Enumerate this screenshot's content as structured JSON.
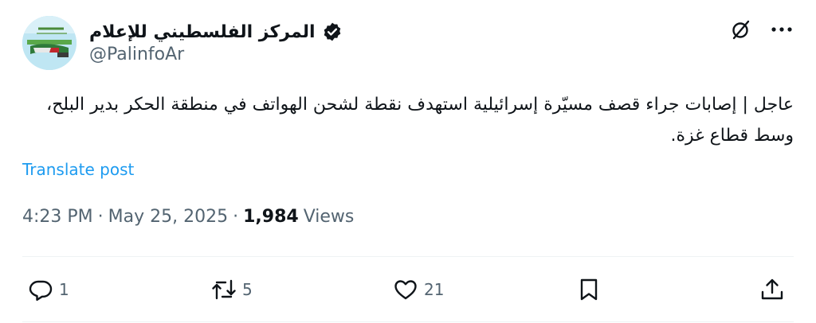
{
  "account": {
    "display_name": "المركز الفلسطيني للإعلام",
    "handle": "@PalinfoAr",
    "verified": true,
    "avatar_icon": "palinfo-logo"
  },
  "tweet": {
    "text": "عاجل | إصابات جراء قصف مسيّرة إسرائيلية استهدف نقطة لشحن الهواتف في منطقة الحكر بدير البلح، وسط قطاع غزة.",
    "translate_label": "Translate post"
  },
  "meta": {
    "time": "4:23 PM",
    "separator": "·",
    "date": "May 25, 2025",
    "separator2": "·",
    "views_count": "1,984",
    "views_label": "Views"
  },
  "actions": {
    "reply_count": "1",
    "retweet_count": "5",
    "like_count": "21"
  },
  "colors": {
    "text": "#0f1419",
    "secondary": "#536471",
    "link": "#1d9bf0",
    "divider": "#eff3f4"
  },
  "icons": [
    "grok-icon",
    "more-icon",
    "verified-badge-icon",
    "reply-icon",
    "retweet-icon",
    "like-icon",
    "bookmark-icon",
    "share-icon"
  ]
}
